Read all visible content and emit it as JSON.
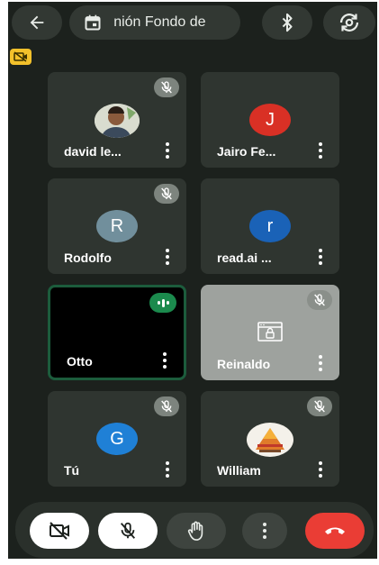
{
  "topbar": {
    "meeting_title": " nión Fondo de",
    "back_icon": "arrow-left-icon",
    "calendar_icon": "calendar-icon",
    "bluetooth_icon": "bluetooth-icon",
    "switch_camera_icon": "camera-switch-icon"
  },
  "colors": {
    "background": "#1c211d",
    "tile": "#2f3530",
    "hangup": "#ea3d35",
    "badge": "#f3c12b",
    "speaking": "#1b8a4d"
  },
  "participants": [
    {
      "name": "david le...",
      "avatar_type": "photo",
      "muted": true
    },
    {
      "name": "Jairo Fe...",
      "initial": "J",
      "avatar_color": "#d93025",
      "muted": false
    },
    {
      "name": "Rodolfo",
      "initial": "R",
      "avatar_color": "#718f9c",
      "muted": true
    },
    {
      "name": "read.ai ...",
      "initial": "r",
      "avatar_color": "#1a62b7",
      "muted": false
    },
    {
      "name": "Otto",
      "avatar_type": "video-black",
      "speaking": true
    },
    {
      "name": "Reinaldo",
      "avatar_type": "video-paused",
      "muted": true
    },
    {
      "name": "Tú",
      "initial": "G",
      "avatar_color": "#1f80d6",
      "muted": true
    },
    {
      "name": "William",
      "avatar_type": "logo",
      "muted": true
    }
  ],
  "controls": [
    {
      "icon": "camera-off-icon"
    },
    {
      "icon": "mic-off-icon"
    },
    {
      "icon": "raise-hand-icon"
    },
    {
      "icon": "more-options-icon"
    },
    {
      "icon": "hang-up-icon"
    }
  ]
}
